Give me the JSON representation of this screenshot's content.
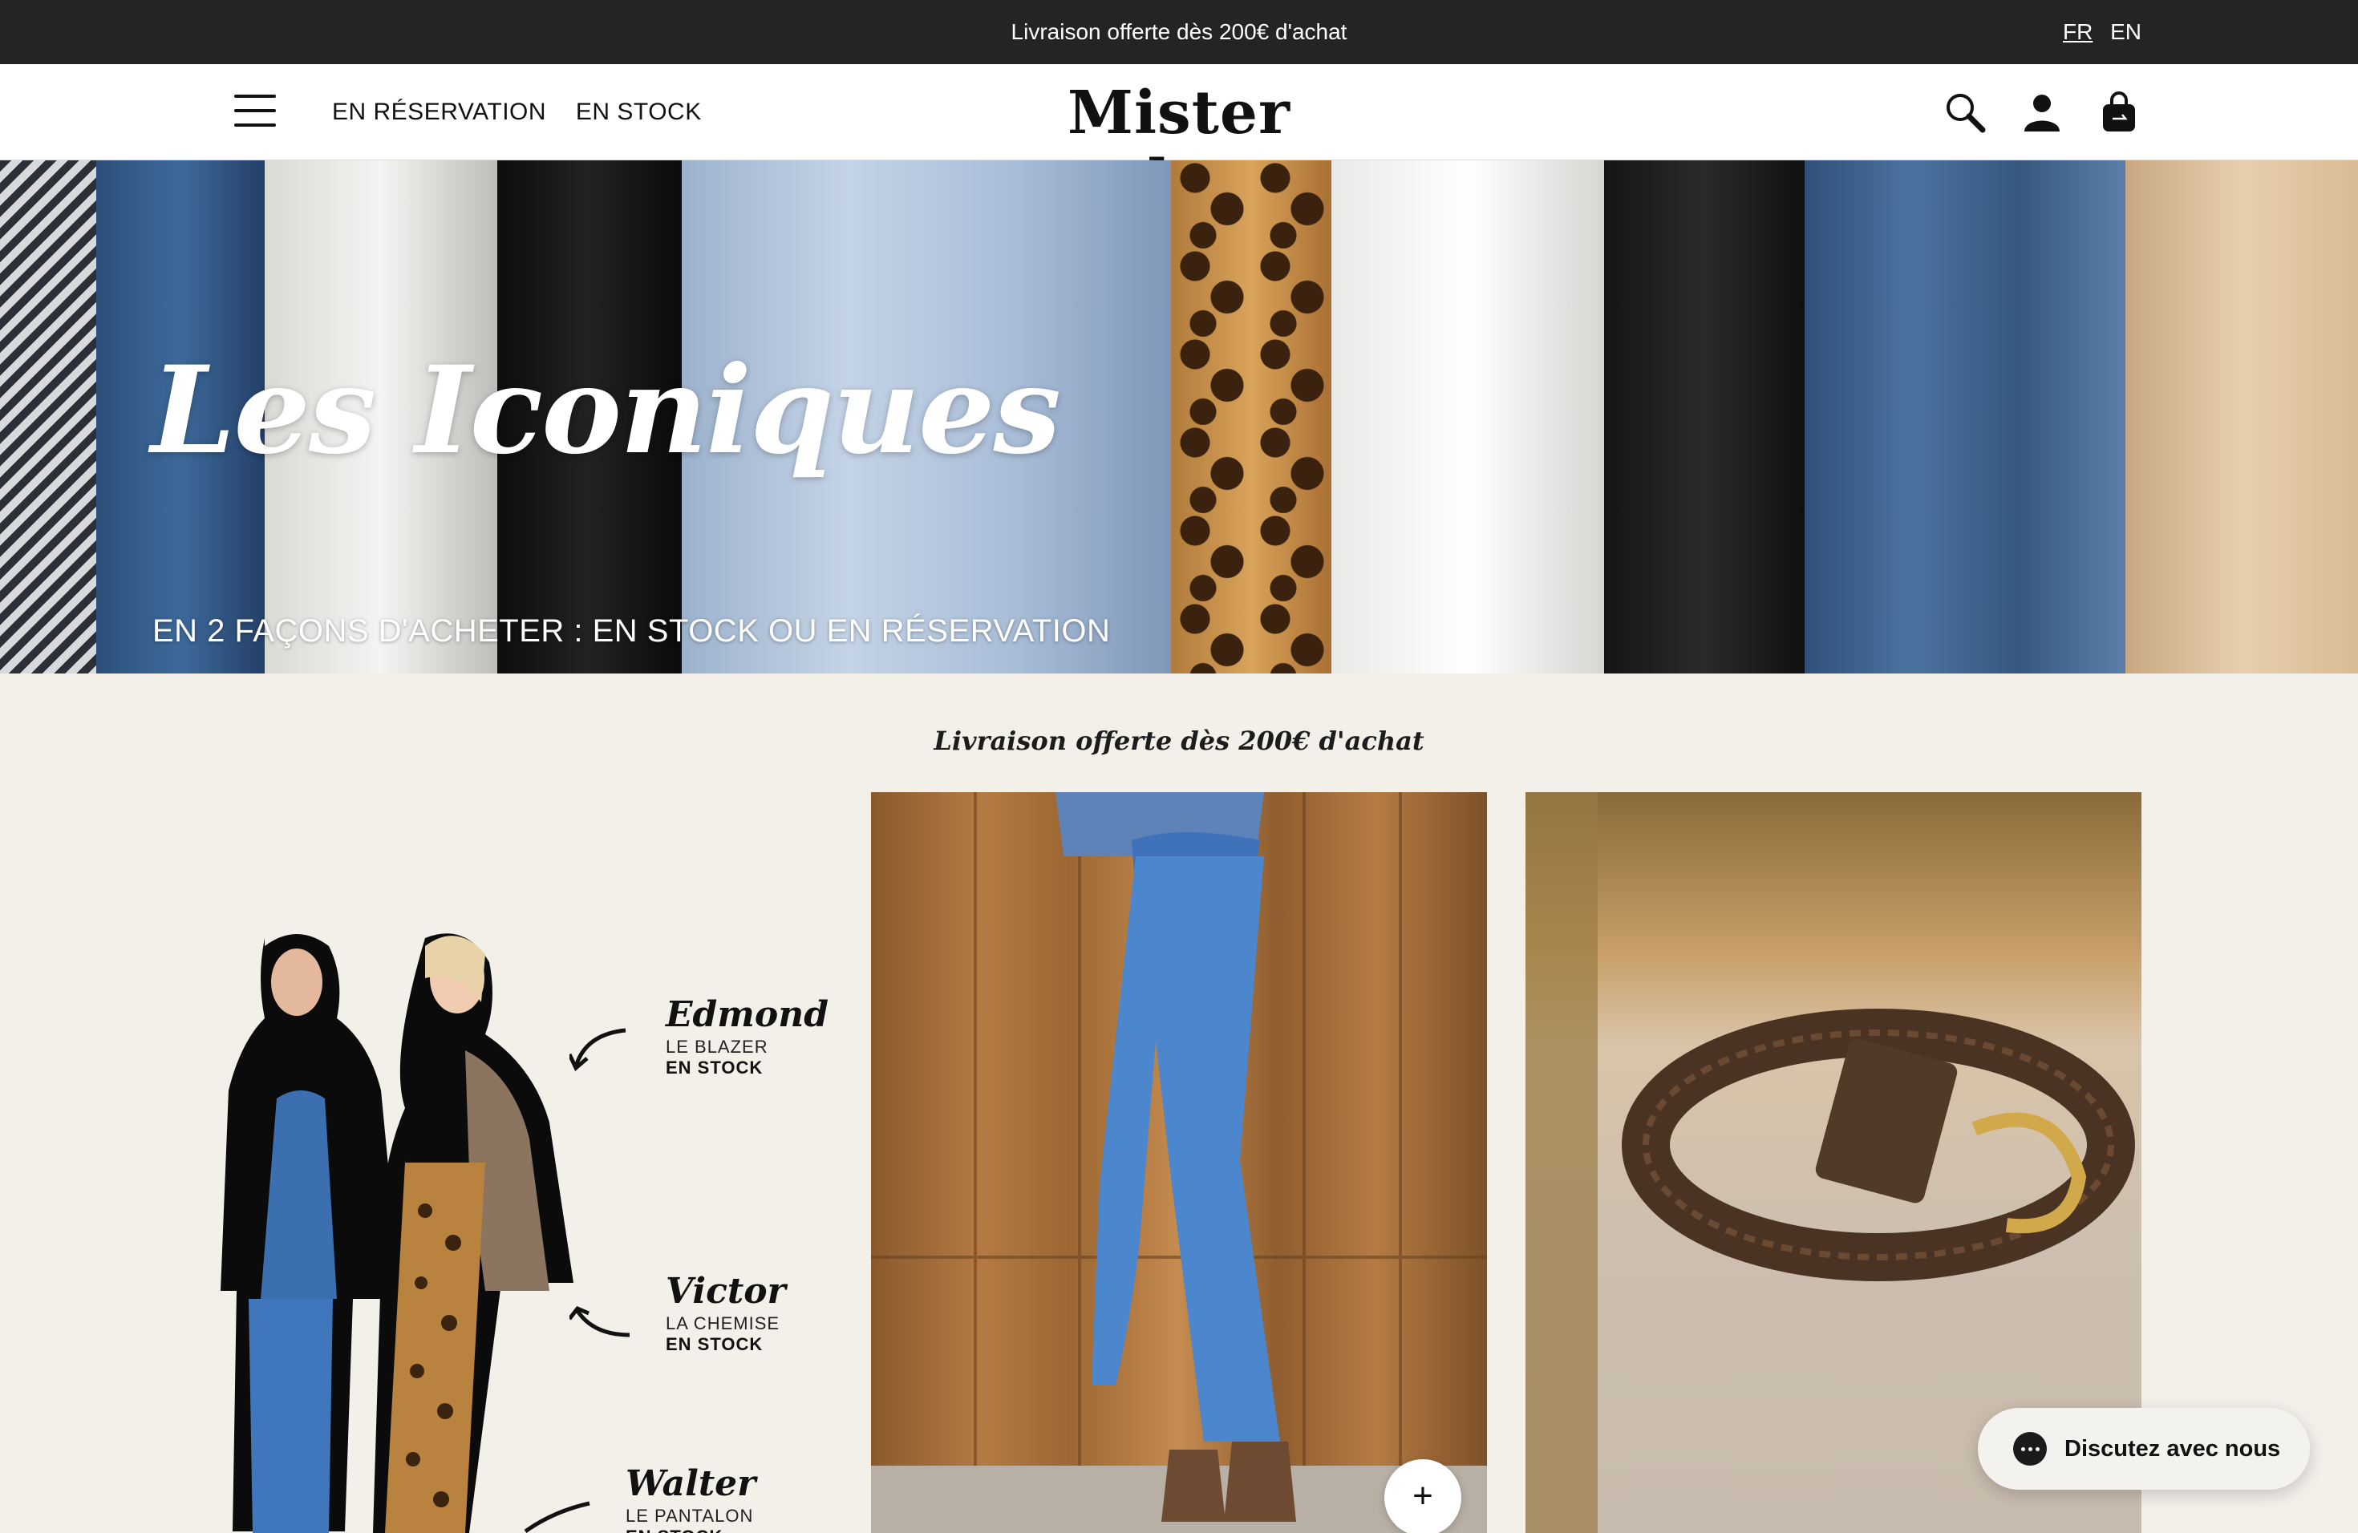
{
  "announcement": {
    "text": "Livraison offerte dès 200€ d'achat",
    "languages": [
      {
        "code": "FR",
        "active": true
      },
      {
        "code": "EN",
        "active": false
      }
    ]
  },
  "header": {
    "menu_icon": "hamburger-icon",
    "nav": [
      "EN RÉSERVATION",
      "EN STOCK"
    ],
    "logo": "Mister k.",
    "icons": [
      "search-icon",
      "account-icon",
      "cart-icon"
    ]
  },
  "hero": {
    "title": "Les Iconiques",
    "subtitle": "EN 2 FAÇONS D'ACHETER : EN STOCK OU EN RÉSERVATION"
  },
  "main": {
    "tagline": "Livraison offerte dès 200€ d'achat",
    "looks": [
      {
        "name": "Edmond",
        "kind": "LE BLAZER",
        "stock": "EN STOCK"
      },
      {
        "name": "Victor",
        "kind": "LA CHEMISE",
        "stock": "EN STOCK"
      },
      {
        "name": "Walter",
        "kind": "LE PANTALON",
        "stock": "EN STOCK"
      }
    ],
    "products": [
      {
        "subject": "jeans"
      },
      {
        "subject": "braided-belt"
      }
    ],
    "quick_add_label": "+"
  },
  "chat": {
    "label": "Discutez avec nous",
    "icon": "chat-bubble-icon"
  },
  "colors": {
    "topbar_bg": "#252422",
    "page_bg": "#f3efe9",
    "text": "#111111"
  }
}
